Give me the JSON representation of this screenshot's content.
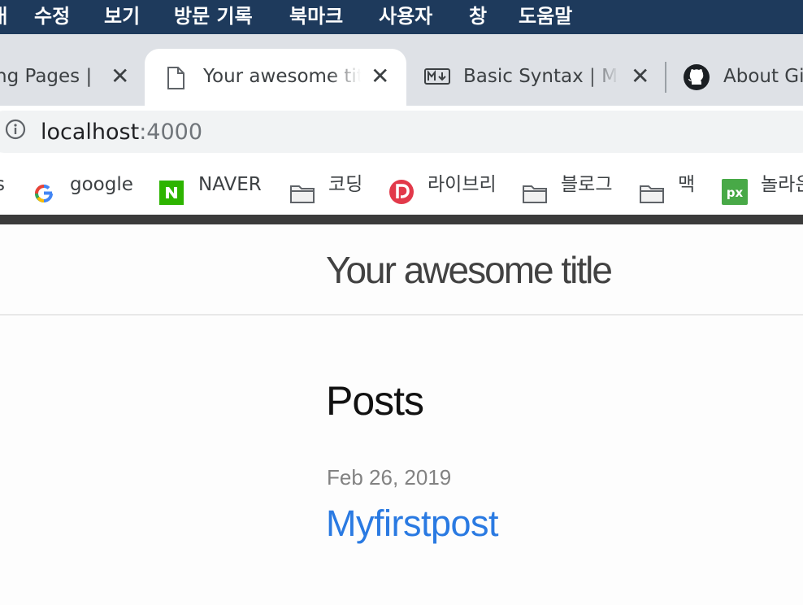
{
  "menubar": {
    "items": [
      "ㅐ",
      "수정",
      "보기",
      "방문 기록",
      "북마크",
      "사용자",
      "창",
      "도움말"
    ]
  },
  "tabs": [
    {
      "title": "ng Pages |",
      "icon": "none",
      "active": false
    },
    {
      "title": "Your awesome title",
      "icon": "document-icon",
      "active": true
    },
    {
      "title": "Basic Syntax | Markdown",
      "icon": "markdown-icon",
      "active": false
    },
    {
      "title": "About GitHub",
      "icon": "github-icon",
      "active": false
    }
  ],
  "tab_close_glyph": "✕",
  "address_bar": {
    "host": "localhost",
    "port": ":4000"
  },
  "bookmarks": [
    {
      "label": "s",
      "icon": "none"
    },
    {
      "label": "google",
      "icon": "google-icon"
    },
    {
      "label": "NAVER",
      "icon": "naver-icon"
    },
    {
      "label": "코딩",
      "icon": "folder-icon"
    },
    {
      "label": "라이브리",
      "icon": "livere-icon"
    },
    {
      "label": "블로그",
      "icon": "folder-icon"
    },
    {
      "label": "맥",
      "icon": "folder-icon"
    },
    {
      "label": "놀라운",
      "icon": "pixabay-icon"
    }
  ],
  "page": {
    "site_title": "Your awesome title",
    "section_heading": "Posts",
    "post": {
      "date": "Feb 26, 2019",
      "title": "Myfirstpost"
    }
  },
  "colors": {
    "menubar_bg": "#1e3a5c",
    "link": "#2a7ae2",
    "naver_green": "#2db400",
    "pixabay_green": "#48a947",
    "livere_red": "#e2394a"
  }
}
